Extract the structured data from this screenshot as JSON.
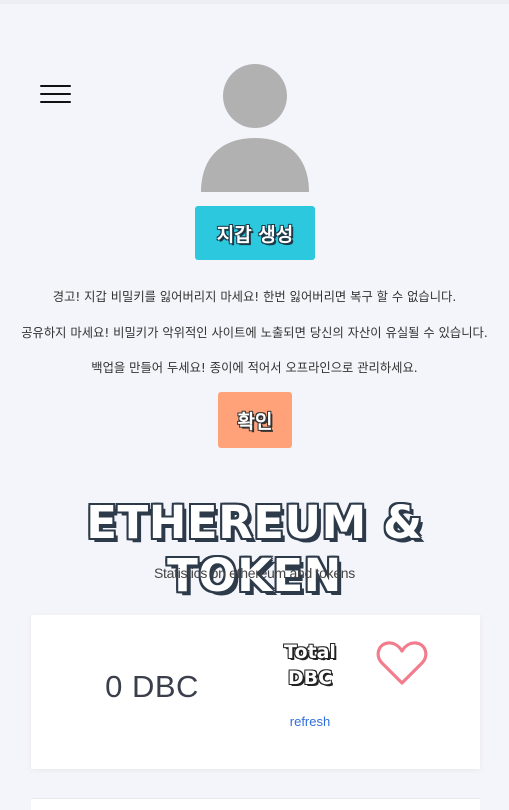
{
  "header": {
    "menu_icon": "hamburger-menu-icon"
  },
  "profile": {
    "avatar_icon": "user-avatar-icon",
    "avatar_color": "#b1b1b1"
  },
  "wallet": {
    "create_button_label": "지갑 생성",
    "create_button_color": "#2bc8de",
    "warnings": [
      "경고! 지갑 비밀키를 잃어버리지 마세요! 한번 잃어버리면 복구 할 수 없습니다.",
      "공유하지 마세요! 비밀키가 악위적인 사이트에 노출되면 당신의 자산이 유실될 수 있습니다.",
      "백업을 만들어 두세요! 종이에 적어서 오프라인으로 관리하세요."
    ],
    "confirm_button_label": "확인",
    "confirm_button_color": "#ffa27a"
  },
  "stats": {
    "title": "ETHEREUM & TOKEN",
    "subtitle": "Statistics on ethereum and tokens"
  },
  "card": {
    "value": "0 DBC",
    "label_line1": "Total",
    "label_line2": "DBC",
    "refresh_label": "refresh",
    "heart_icon": "heart-icon",
    "heart_color": "#f27c8c"
  }
}
